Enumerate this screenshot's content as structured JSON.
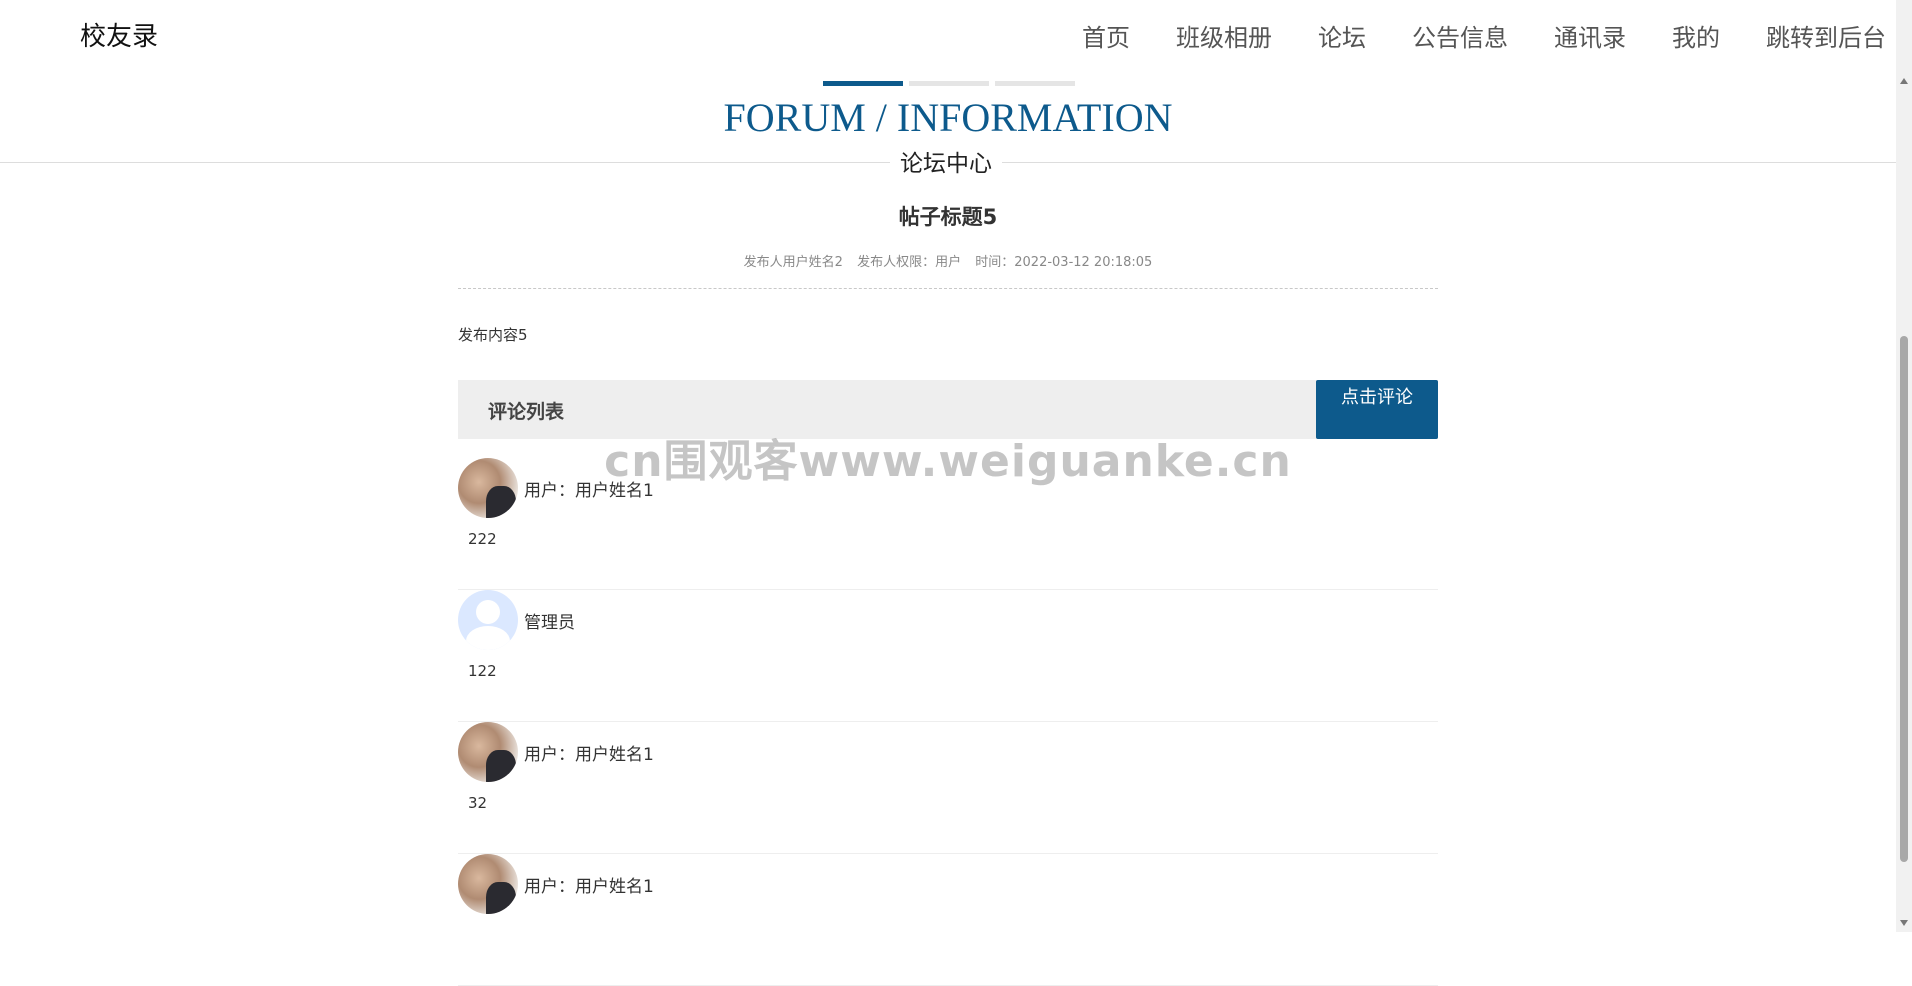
{
  "brand": "校友录",
  "nav": {
    "items": [
      "首页",
      "班级相册",
      "论坛",
      "公告信息",
      "通讯录",
      "我的",
      "跳转到后台"
    ]
  },
  "section": {
    "en_title": "FORUM / INFORMATION",
    "cn_title": "论坛中心"
  },
  "post": {
    "title": "帖子标题5",
    "author": "发布人用户姓名2",
    "role": "发布人权限：用户",
    "time": "时间：2022-03-12 20:18:05",
    "content": "发布内容5"
  },
  "comments_section": {
    "header": "评论列表",
    "button_label": "点击评论"
  },
  "comments": [
    {
      "avatar": "user-photo-avatar",
      "user": "用户：用户姓名1",
      "text": "222"
    },
    {
      "avatar": "default-user-avatar",
      "user": "管理员",
      "text": "122"
    },
    {
      "avatar": "user-photo-avatar",
      "user": "用户：用户姓名1",
      "text": "32"
    },
    {
      "avatar": "user-photo-avatar",
      "user": "用户：用户姓名1",
      "text": ""
    }
  ],
  "watermark": "cn围观客www.weiguanke.cn",
  "colors": {
    "accent": "#0d5a8c",
    "comment_bar_bg": "#eeeeee",
    "tab_inactive": "#e5e5e5"
  }
}
